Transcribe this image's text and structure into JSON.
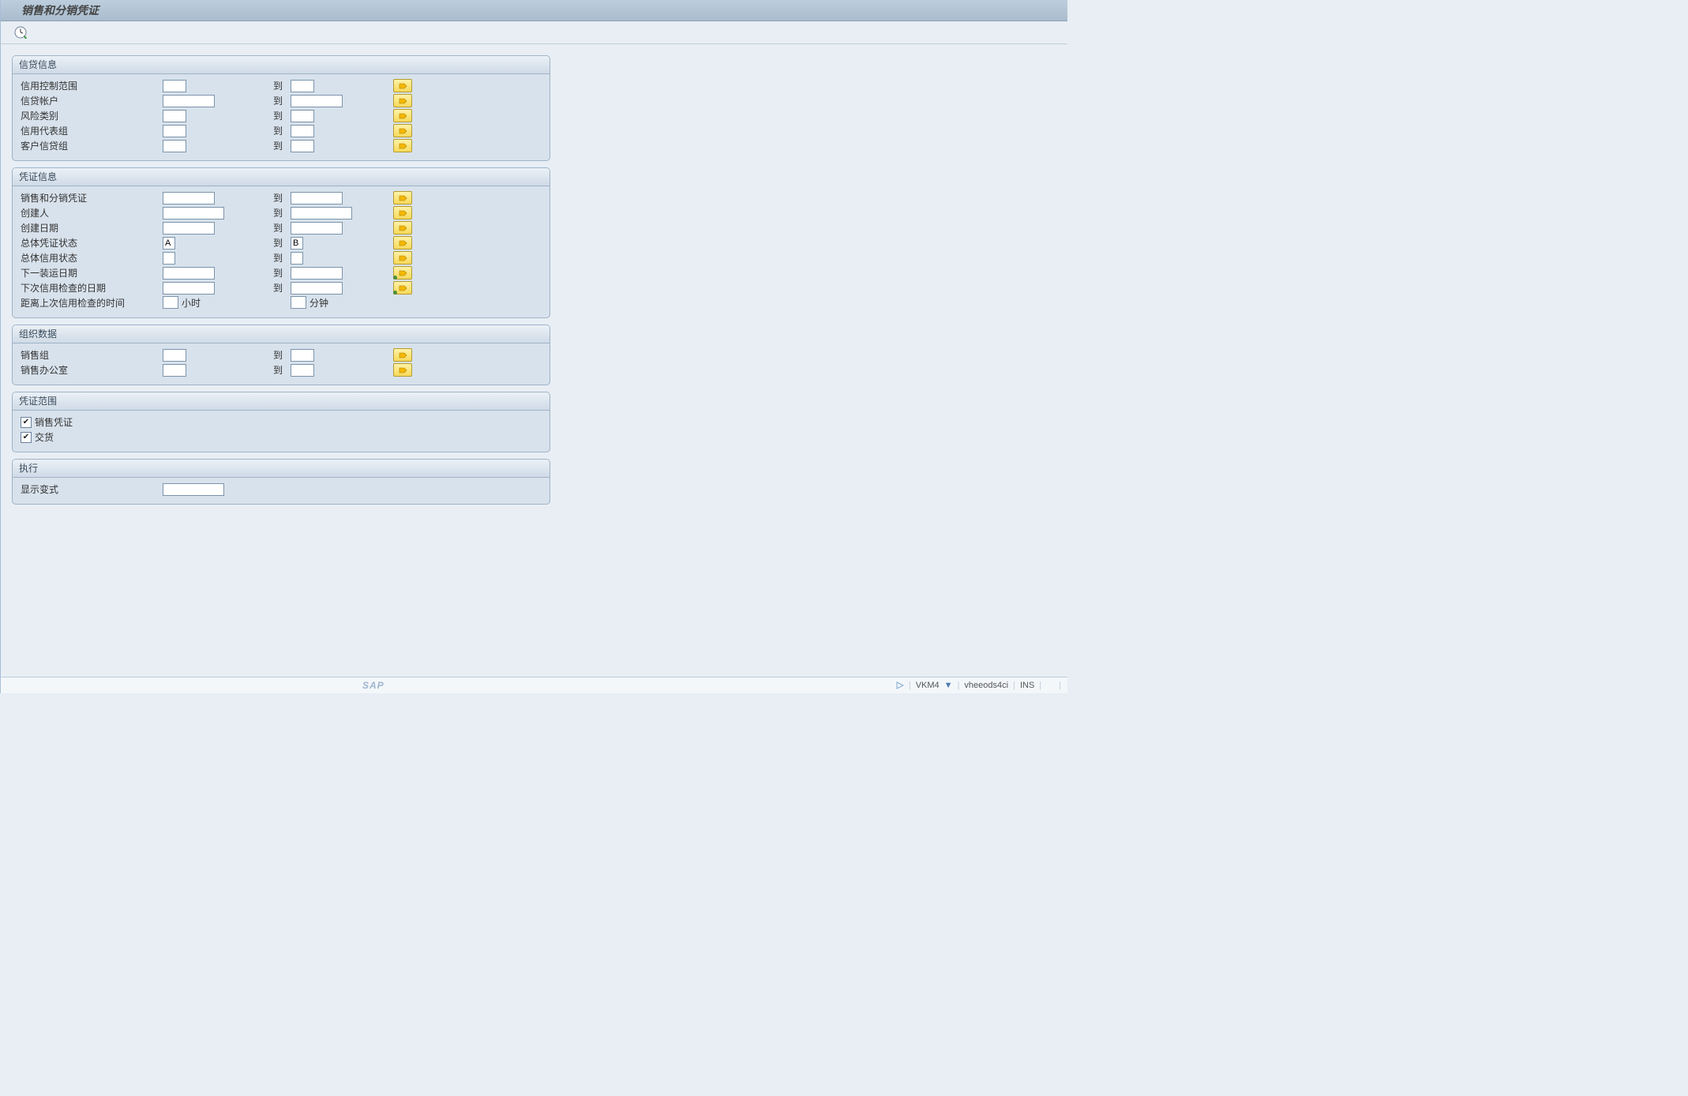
{
  "title": "销售和分销凭证",
  "groups": {
    "credit": {
      "title": "信贷信息",
      "rows": [
        "信用控制范围",
        "信贷帐户",
        "风险类别",
        "信用代表组",
        "客户信贷组"
      ],
      "to": "到"
    },
    "doc": {
      "title": "凭证信息",
      "rows": {
        "sddoc": "销售和分销凭证",
        "creator": "创建人",
        "cdate": "创建日期",
        "overall": "总体凭证状态",
        "overall_from": "A",
        "overall_to_v": "B",
        "credst": "总体信用状态",
        "nextship": "下一装运日期",
        "nextcheck": "下次信用检查的日期",
        "since": "距离上次信用检查的时间",
        "hours": "小时",
        "minutes": "分钟"
      },
      "to": "到"
    },
    "org": {
      "title": "组织数据",
      "rows": [
        "销售组",
        "销售办公室"
      ],
      "to": "到"
    },
    "scope": {
      "title": "凭证范围",
      "sales": "销售凭证",
      "delivery": "交货"
    },
    "exec": {
      "title": "执行",
      "variant": "显示变式"
    }
  },
  "status": {
    "tcode": "VKM4",
    "system": "vheeods4ci",
    "mode": "INS"
  }
}
